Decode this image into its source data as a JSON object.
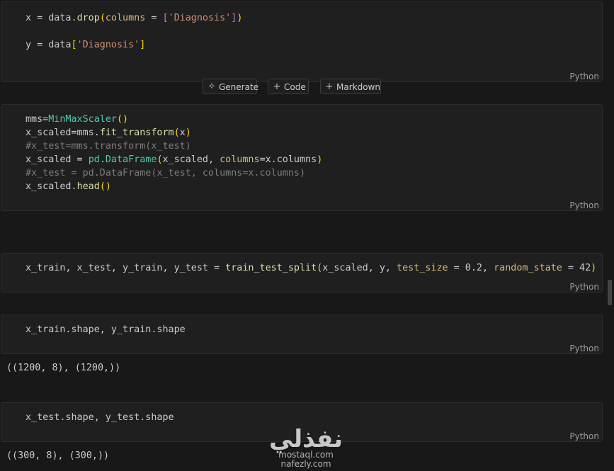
{
  "cells": [
    {
      "language": "Python",
      "lines": [
        [
          {
            "t": "x = data.",
            "c": ""
          },
          {
            "t": "drop",
            "c": "t-fn"
          },
          {
            "t": "(",
            "c": "t-br"
          },
          {
            "t": "columns",
            "c": "t-kw"
          },
          {
            "t": " = ",
            "c": ""
          },
          {
            "t": "[",
            "c": "t-br2"
          },
          {
            "t": "'Diagnosis'",
            "c": "t-str"
          },
          {
            "t": "]",
            "c": "t-br2"
          },
          {
            "t": ")",
            "c": "t-br"
          }
        ],
        [
          {
            "t": "",
            "c": ""
          }
        ],
        [
          {
            "t": "y = data",
            "c": ""
          },
          {
            "t": "[",
            "c": "t-br"
          },
          {
            "t": "'Diagnosis'",
            "c": "t-str"
          },
          {
            "t": "]",
            "c": "t-br"
          }
        ]
      ]
    },
    {
      "language": "Python",
      "lines": [
        [
          {
            "t": "mms=",
            "c": ""
          },
          {
            "t": "MinMaxScaler",
            "c": "t-cls"
          },
          {
            "t": "()",
            "c": "t-br"
          }
        ],
        [
          {
            "t": "x_scaled=mms.",
            "c": ""
          },
          {
            "t": "fit_transform",
            "c": "t-fn"
          },
          {
            "t": "(",
            "c": "t-br"
          },
          {
            "t": "x",
            "c": ""
          },
          {
            "t": ")",
            "c": "t-br"
          }
        ],
        [
          {
            "t": "#x_test=mms.transform(x_test)",
            "c": "t-cm2"
          }
        ],
        [
          {
            "t": "x_scaled = ",
            "c": ""
          },
          {
            "t": "pd",
            "c": "t-cls"
          },
          {
            "t": ".",
            "c": ""
          },
          {
            "t": "DataFrame",
            "c": "t-cls"
          },
          {
            "t": "(",
            "c": "t-br"
          },
          {
            "t": "x_scaled, ",
            "c": ""
          },
          {
            "t": "columns",
            "c": "t-kw"
          },
          {
            "t": "=x.columns",
            "c": ""
          },
          {
            "t": ")",
            "c": "t-br"
          }
        ],
        [
          {
            "t": "#x_test = pd.DataFrame(x_test, columns=x.columns)",
            "c": "t-cm2"
          }
        ],
        [
          {
            "t": "x_scaled.",
            "c": ""
          },
          {
            "t": "head",
            "c": "t-fn"
          },
          {
            "t": "()",
            "c": "t-br"
          }
        ]
      ]
    },
    {
      "language": "Python",
      "lines": [
        [
          {
            "t": "x_train, x_test, y_train, y_test = ",
            "c": ""
          },
          {
            "t": "train_test_split",
            "c": "t-fn"
          },
          {
            "t": "(",
            "c": "t-br"
          },
          {
            "t": "x_scaled, y, ",
            "c": ""
          },
          {
            "t": "test_size",
            "c": "t-kw"
          },
          {
            "t": " = 0.2, ",
            "c": ""
          },
          {
            "t": "random_state",
            "c": "t-kw"
          },
          {
            "t": " = 42",
            "c": ""
          },
          {
            "t": ")",
            "c": "t-br"
          }
        ]
      ]
    },
    {
      "language": "Python",
      "lines": [
        [
          {
            "t": "x_train.shape, y_train.shape",
            "c": ""
          }
        ]
      ]
    },
    {
      "language": "Python",
      "lines": [
        [
          {
            "t": "x_test.shape, y_test.shape",
            "c": ""
          }
        ]
      ]
    }
  ],
  "toolbar": {
    "generate_label": "Generate",
    "code_label": "Code",
    "markdown_label": "Markdown"
  },
  "outputs": {
    "train_shape": "((1200, 8), (1200,))",
    "test_shape": "((300, 8), (300,))"
  },
  "watermark": {
    "logo_text": "نفذلي",
    "line1": "mostaql.com",
    "line2": "nafezly.com"
  }
}
